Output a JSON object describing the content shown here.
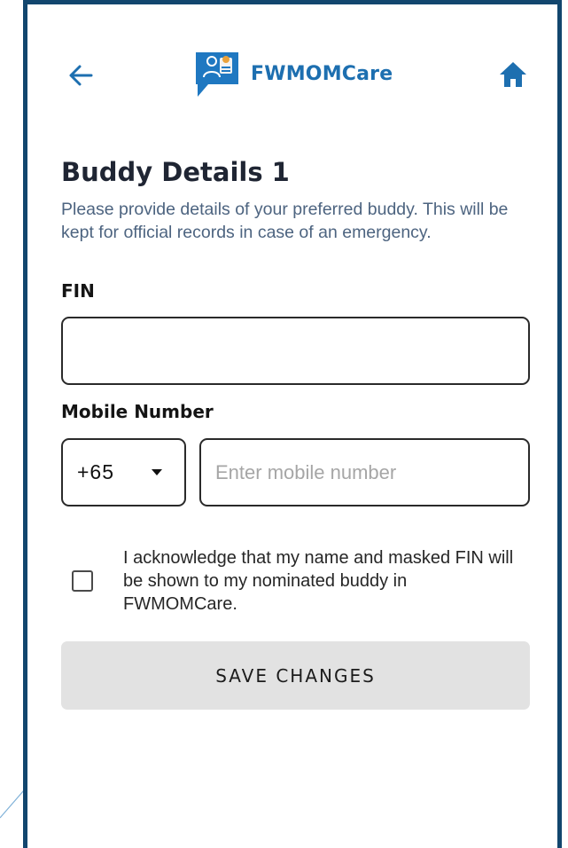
{
  "app": {
    "name": "FWMOMCare",
    "brand_color": "#1d6fb0",
    "frame_color": "#12466e"
  },
  "header": {
    "back_icon": "arrow-left-icon",
    "home_icon": "home-icon",
    "logo_icon": "chat-people-icon"
  },
  "form": {
    "title": "Buddy Details 1",
    "subtitle": "Please provide details of your preferred buddy. This will be kept for official records in case of an emergency.",
    "fin": {
      "label": "FIN",
      "value": ""
    },
    "mobile": {
      "label": "Mobile Number",
      "country_code": "+65",
      "value": "",
      "placeholder": "Enter mobile number"
    },
    "acknowledge": {
      "text": "I acknowledge that my name and masked FIN will be shown to my nominated buddy in FWMOMCare.",
      "checked": false
    },
    "save_label": "SAVE CHANGES"
  }
}
